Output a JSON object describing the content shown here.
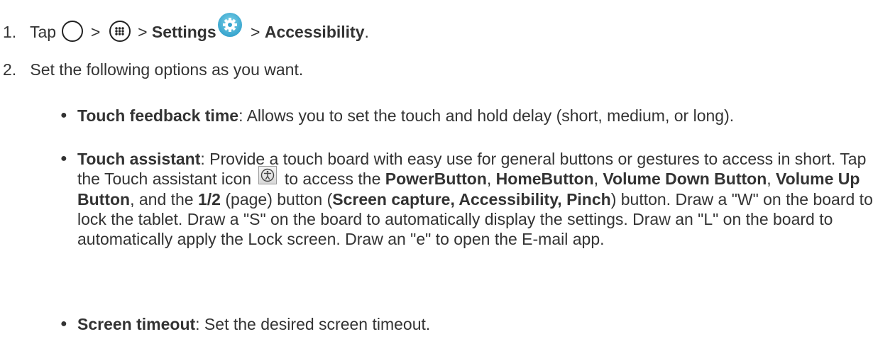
{
  "step1": {
    "number": "1.",
    "tap": "Tap",
    "sep1": ">",
    "sep2": ">",
    "settings": "Settings",
    "sep3": ">",
    "accessibility": "Accessibility",
    "period": "."
  },
  "step2": {
    "number": "2.",
    "text": "Set the following options as you want."
  },
  "options": {
    "touch_feedback": {
      "label": "Touch feedback time",
      "desc": ": Allows you to set the touch and hold delay (short, medium, or long)."
    },
    "touch_assistant": {
      "label": "Touch assistant",
      "desc1": ": Provide a touch board with easy use for general buttons or gestures to access in short. Tap the Touch assistant icon",
      "desc2": "to access the",
      "power_button": "PowerButton",
      "comma1": ",",
      "home_button": "HomeButton",
      "comma2": ",",
      "vol_down": "Volume Down Button",
      "comma3": ",",
      "vol_up": "Volume Up Button",
      "and_the": ", and the",
      "page": "1/2",
      "page_button": "(page) button (",
      "extras": "Screen capture, Accessibility, Pinch",
      "rest": ") button. Draw a \"W\" on the board to lock the tablet. Draw a \"S\" on the board to automatically display the settings. Draw an \"L\" on the board to automatically apply the Lock screen. Draw an \"e\" to open the E-mail app."
    },
    "screen_timeout": {
      "label": "Screen timeout",
      "desc": ": Set the desired screen timeout."
    }
  },
  "icons": {
    "home": "home-circle-icon",
    "apps": "apps-icon",
    "settings": "settings-gear-icon",
    "touch_assistant": "touch-assistant-icon"
  }
}
